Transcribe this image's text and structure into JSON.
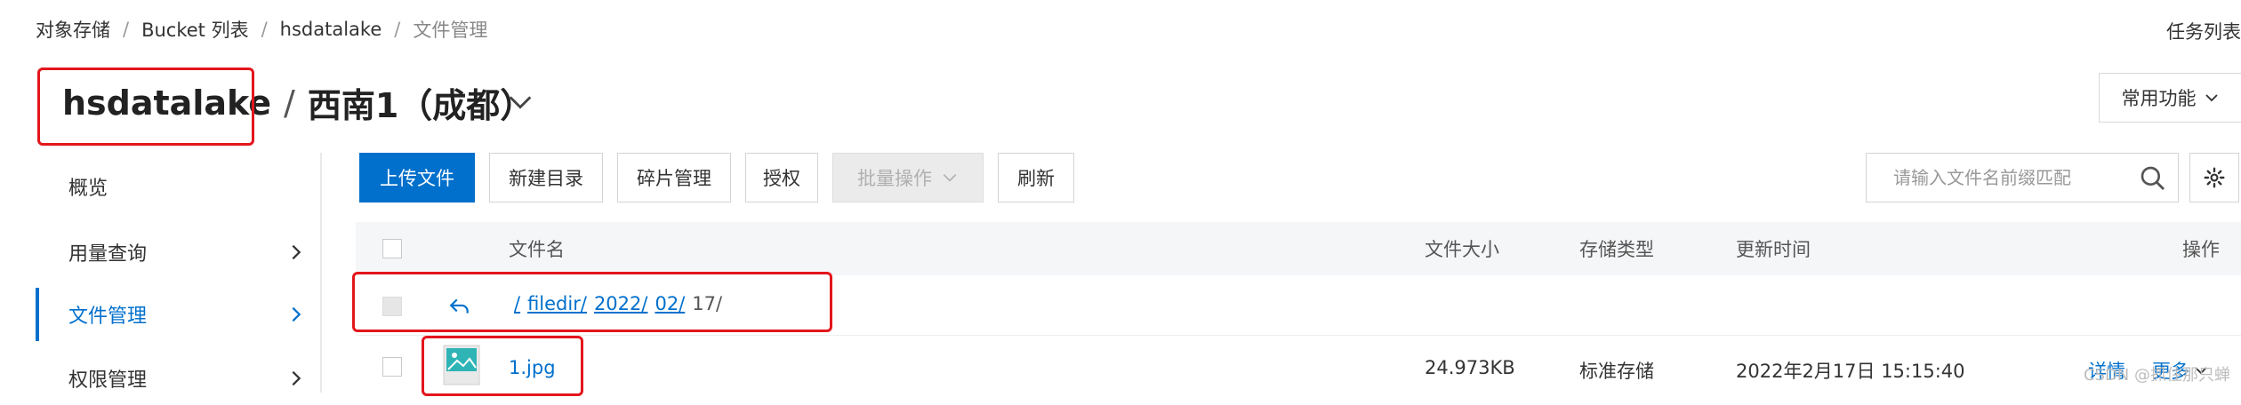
{
  "breadcrumb": [
    "对象存储",
    "Bucket 列表",
    "hsdatalake",
    "文件管理"
  ],
  "header": {
    "task_list": "任务列表",
    "bucket_name": "hsdatalake",
    "region": "西南1（成都）",
    "common_functions": "常用功能"
  },
  "sidebar": {
    "items": [
      {
        "label": "概览",
        "has_chevron": false,
        "active": false
      },
      {
        "label": "用量查询",
        "has_chevron": true,
        "active": false
      },
      {
        "label": "文件管理",
        "has_chevron": true,
        "active": true
      },
      {
        "label": "权限管理",
        "has_chevron": true,
        "active": false
      }
    ]
  },
  "toolbar": {
    "upload": "上传文件",
    "new_dir": "新建目录",
    "fragment": "碎片管理",
    "authorize": "授权",
    "batch": "批量操作",
    "refresh": "刷新",
    "search_placeholder": "请输入文件名前缀匹配"
  },
  "table": {
    "headers": {
      "name": "文件名",
      "size": "文件大小",
      "storage": "存储类型",
      "updated": "更新时间",
      "actions": "操作"
    },
    "path": [
      "/",
      "filedir/",
      "2022/",
      "02/"
    ],
    "path_current": "17/",
    "rows": [
      {
        "name": "1.jpg",
        "size": "24.973KB",
        "storage": "标准存储",
        "updated": "2022年2月17日 15:15:40",
        "detail": "详情",
        "more": "更多"
      }
    ]
  },
  "watermark": "CSDN @抓住那只蝉",
  "colors": {
    "primary": "#0070cc",
    "highlight": "#e3161c",
    "header_bg": "#f5f6f8"
  }
}
